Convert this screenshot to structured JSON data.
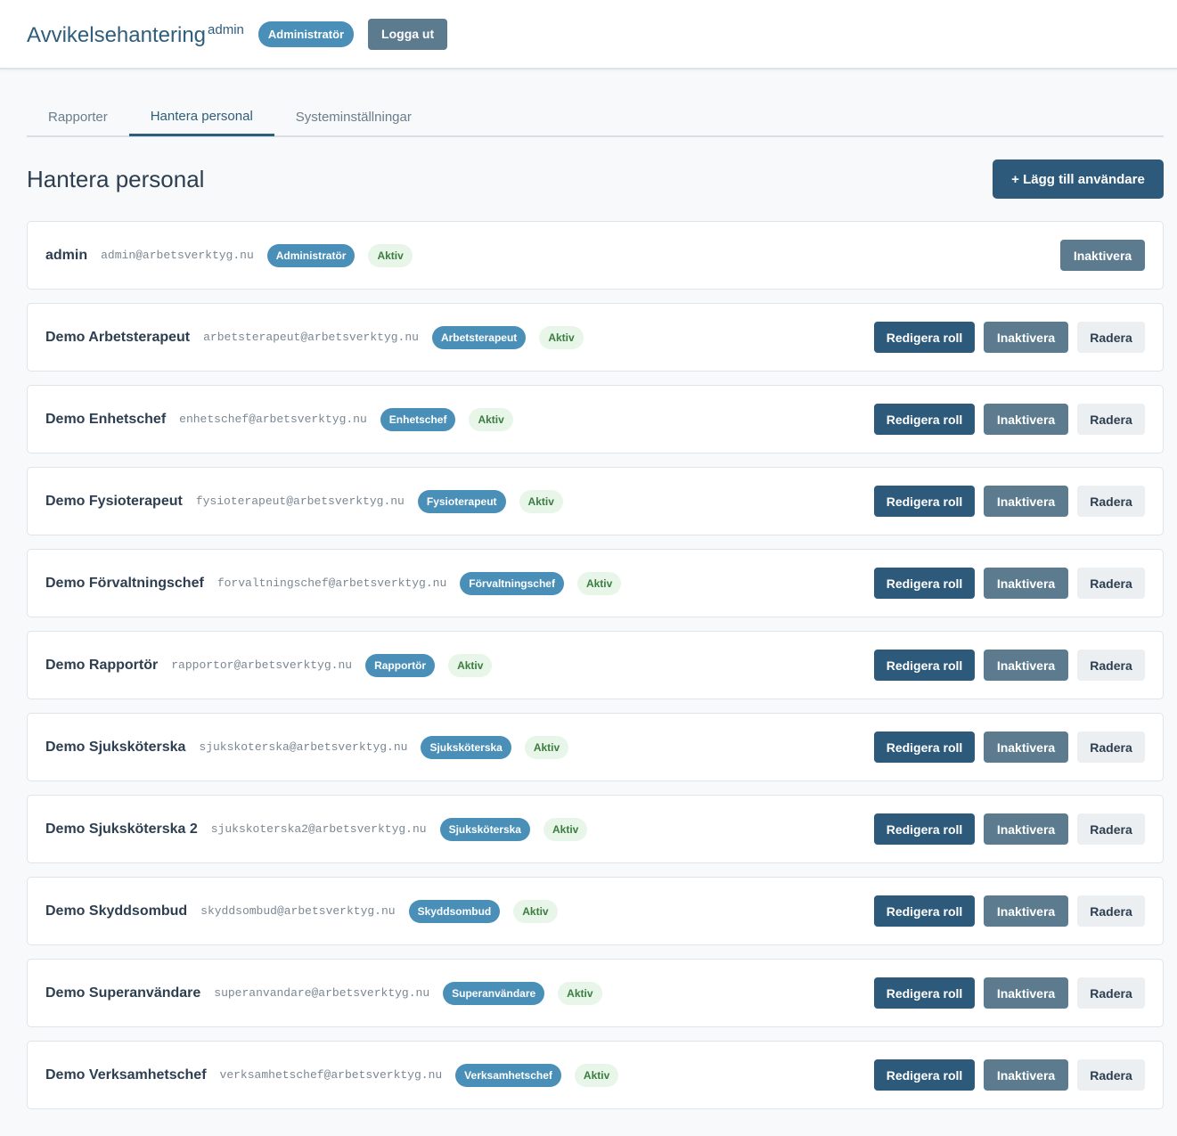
{
  "header": {
    "title": "Avvikelsehantering",
    "username": "admin",
    "role_badge": "Administratör",
    "logout_label": "Logga ut"
  },
  "tabs": [
    {
      "label": "Rapporter",
      "active": false
    },
    {
      "label": "Hantera personal",
      "active": true
    },
    {
      "label": "Systeminställningar",
      "active": false
    }
  ],
  "page": {
    "title": "Hantera personal",
    "add_button": "+ Lägg till användare"
  },
  "buttons": {
    "edit_role": "Redigera roll",
    "deactivate": "Inaktivera",
    "delete": "Radera"
  },
  "users": [
    {
      "name": "admin",
      "email": "admin@arbetsverktyg.nu",
      "role": "Administratör",
      "status": "Aktiv",
      "self": true
    },
    {
      "name": "Demo Arbetsterapeut",
      "email": "arbetsterapeut@arbetsverktyg.nu",
      "role": "Arbetsterapeut",
      "status": "Aktiv",
      "self": false
    },
    {
      "name": "Demo Enhetschef",
      "email": "enhetschef@arbetsverktyg.nu",
      "role": "Enhetschef",
      "status": "Aktiv",
      "self": false
    },
    {
      "name": "Demo Fysioterapeut",
      "email": "fysioterapeut@arbetsverktyg.nu",
      "role": "Fysioterapeut",
      "status": "Aktiv",
      "self": false
    },
    {
      "name": "Demo Förvaltningschef",
      "email": "forvaltningschef@arbetsverktyg.nu",
      "role": "Förvaltningschef",
      "status": "Aktiv",
      "self": false
    },
    {
      "name": "Demo Rapportör",
      "email": "rapportor@arbetsverktyg.nu",
      "role": "Rapportör",
      "status": "Aktiv",
      "self": false
    },
    {
      "name": "Demo Sjuksköterska",
      "email": "sjukskoterska@arbetsverktyg.nu",
      "role": "Sjuksköterska",
      "status": "Aktiv",
      "self": false
    },
    {
      "name": "Demo Sjuksköterska 2",
      "email": "sjukskoterska2@arbetsverktyg.nu",
      "role": "Sjuksköterska",
      "status": "Aktiv",
      "self": false
    },
    {
      "name": "Demo Skyddsombud",
      "email": "skyddsombud@arbetsverktyg.nu",
      "role": "Skyddsombud",
      "status": "Aktiv",
      "self": false
    },
    {
      "name": "Demo Superanvändare",
      "email": "superanvandare@arbetsverktyg.nu",
      "role": "Superanvändare",
      "status": "Aktiv",
      "self": false
    },
    {
      "name": "Demo Verksamhetschef",
      "email": "verksamhetschef@arbetsverktyg.nu",
      "role": "Verksamhetschef",
      "status": "Aktiv",
      "self": false
    }
  ]
}
